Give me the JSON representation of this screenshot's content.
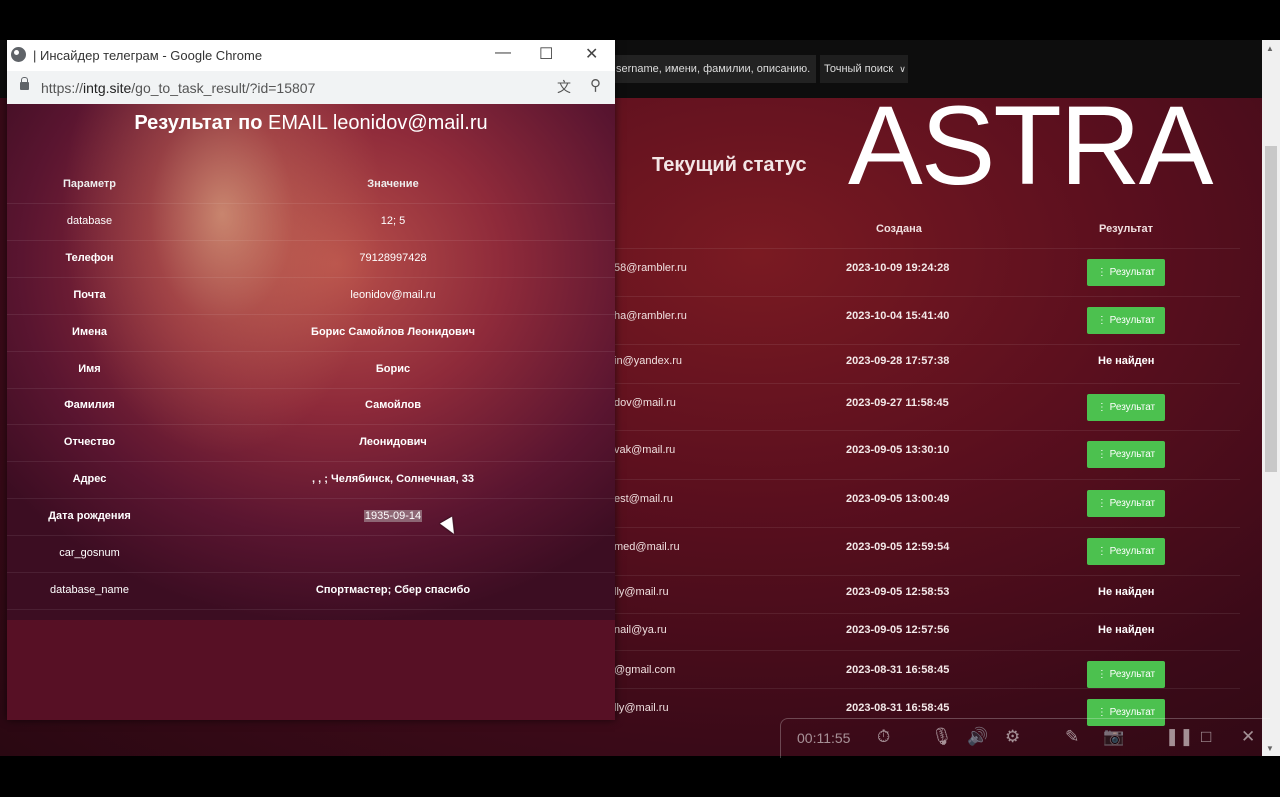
{
  "window": {
    "title": "| Инсайдер телеграм - Google Chrome",
    "minimize_icon": "minimize-icon",
    "maximize_icon": "maximize-icon",
    "close_icon": "close-icon"
  },
  "address_bar": {
    "url_prefix": "https://",
    "url_domain": "intg.site",
    "url_path": "/go_to_task_result/?id=15807"
  },
  "result": {
    "title": "Результат по",
    "title_query": "EMAIL leonidov@mail.ru",
    "header_param": "Параметр",
    "header_value": "Значение",
    "rows": [
      {
        "key": "database",
        "value": "12; 5"
      },
      {
        "key": "Телефон",
        "value": "79128997428"
      },
      {
        "key": "Почта",
        "value": "leonidov@mail.ru"
      },
      {
        "key": "Имена",
        "value": "Борис Самойлов Леонидович"
      },
      {
        "key": "Имя",
        "value": "Борис"
      },
      {
        "key": "Фамилия",
        "value": "Самойлов"
      },
      {
        "key": "Отчество",
        "value": "Леонидович"
      },
      {
        "key": "Адрес",
        "value": ", , ; Челябинск, Солнечная, 33"
      },
      {
        "key": "Дата рождения",
        "value": "1935-09-14"
      },
      {
        "key": "car_gosnum",
        "value": ""
      },
      {
        "key": "database_name",
        "value": "Спортмастер; Сбер спасибо"
      }
    ]
  },
  "background": {
    "search_text": "sername, имени, фамилии, описанию.",
    "search_mode": "Точный поиск",
    "status_title": "Текущий статус",
    "logo": "ASTRA",
    "col_created": "Создана",
    "col_result": "Результат",
    "result_button": "⋮ Результат",
    "not_found": "Не найден",
    "tasks": [
      {
        "email": "58@rambler.ru",
        "date": "2023-10-09 19:24:28",
        "status": "button"
      },
      {
        "email": "ha@rambler.ru",
        "date": "2023-10-04 15:41:40",
        "status": "button"
      },
      {
        "email": "in@yandex.ru",
        "date": "2023-09-28 17:57:38",
        "status": "none"
      },
      {
        "email": "dov@mail.ru",
        "date": "2023-09-27 11:58:45",
        "status": "button"
      },
      {
        "email": "vak@mail.ru",
        "date": "2023-09-05 13:30:10",
        "status": "button"
      },
      {
        "email": "est@mail.ru",
        "date": "2023-09-05 13:00:49",
        "status": "button"
      },
      {
        "email": "med@mail.ru",
        "date": "2023-09-05 12:59:54",
        "status": "button"
      },
      {
        "email": "lly@mail.ru",
        "date": "2023-09-05 12:58:53",
        "status": "none"
      },
      {
        "email": "nail@ya.ru",
        "date": "2023-09-05 12:57:56",
        "status": "none"
      },
      {
        "email": "@gmail.com",
        "date": "2023-08-31 16:58:45",
        "status": "button"
      },
      {
        "email": "lly@mail.ru",
        "date": "2023-08-31 16:58:45",
        "status": "button"
      }
    ]
  },
  "recorder": {
    "time": "00:11:55"
  }
}
